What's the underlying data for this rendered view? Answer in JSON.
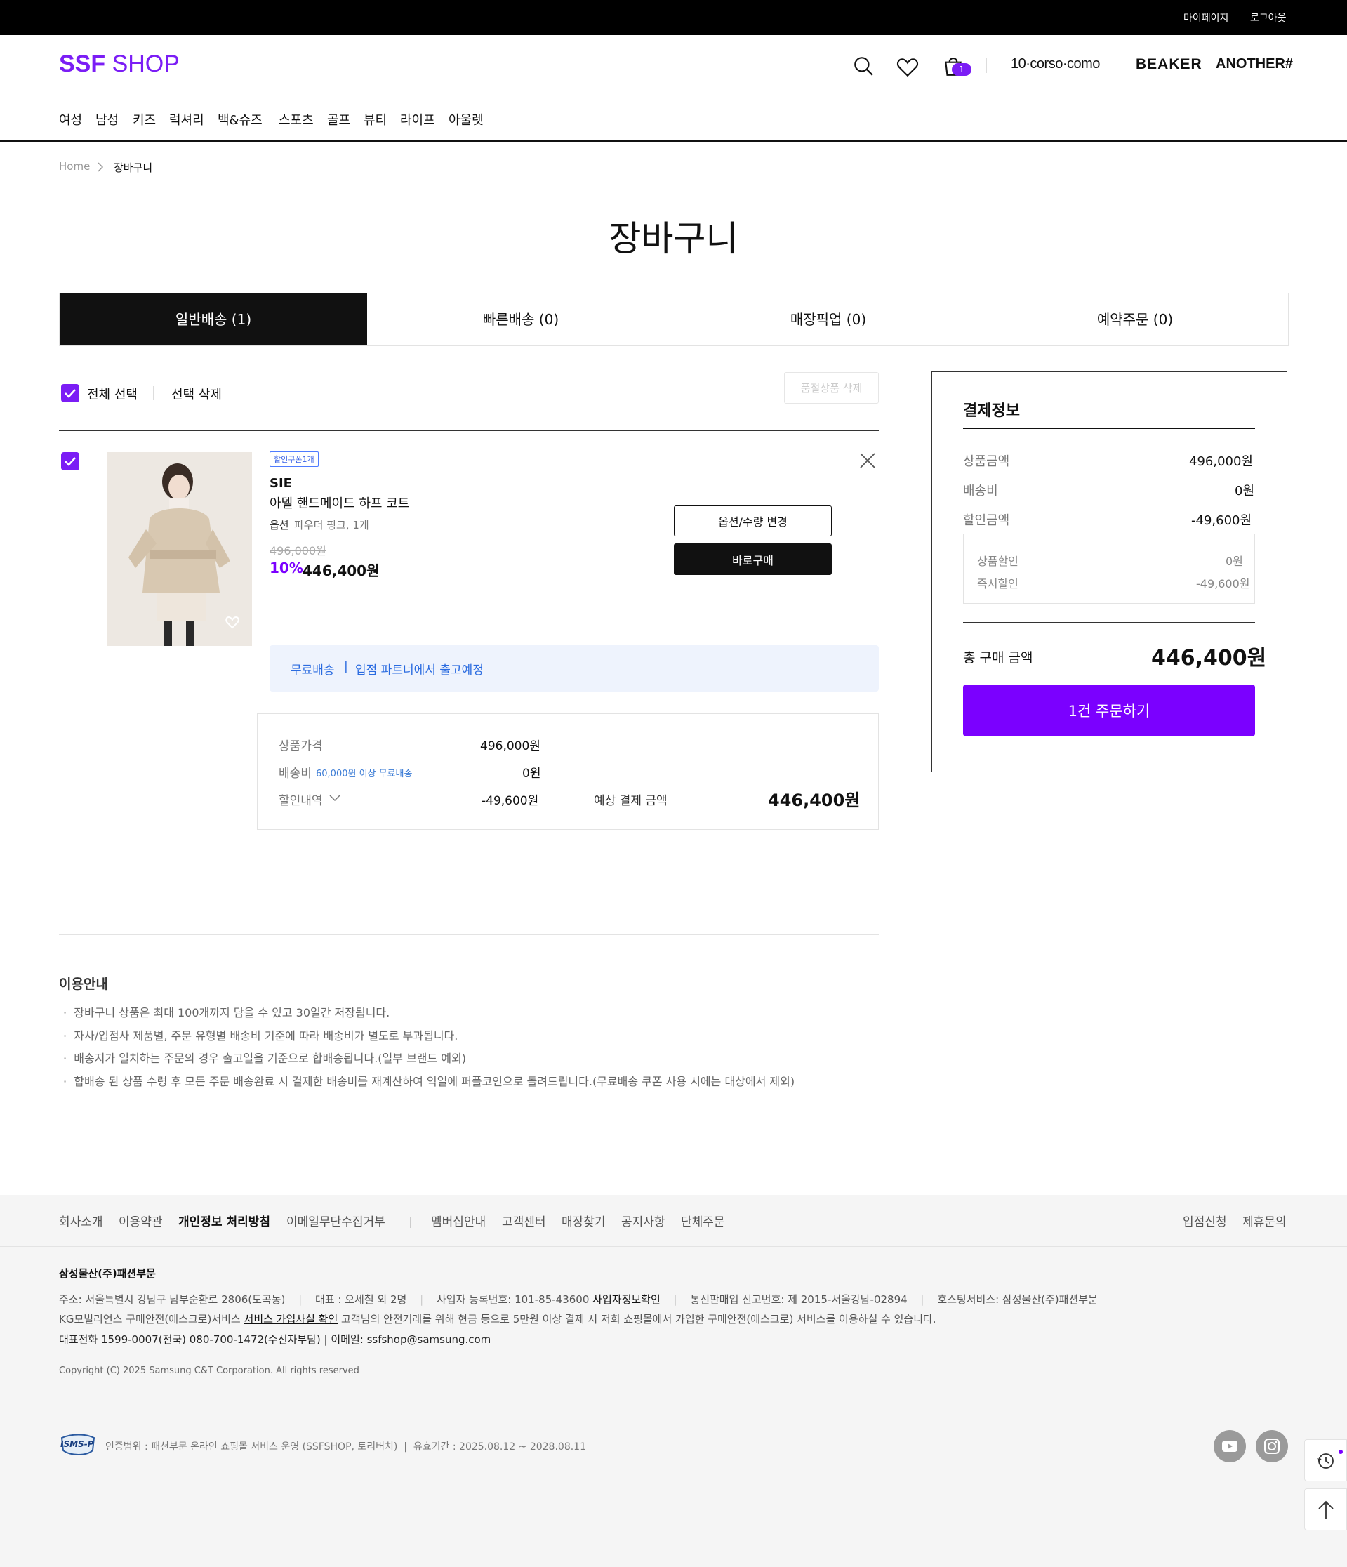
{
  "topbar": {
    "mypage": "마이페이지",
    "logout": "로그아웃"
  },
  "header": {
    "logo_bold": "SSF",
    "logo_light": "SHOP",
    "cart_count": "1",
    "brands": [
      "10·corso·como",
      "BEAKER",
      "ANOTHER#"
    ]
  },
  "nav": [
    "여성",
    "남성",
    "키즈",
    "럭셔리",
    "백&슈즈",
    "스포츠",
    "골프",
    "뷰티",
    "라이프",
    "아울렛"
  ],
  "breadcrumb": {
    "home": "Home",
    "current": "장바구니"
  },
  "page_title": "장바구니",
  "tabs": [
    "일반배송 (1)",
    "빠른배송 (0)",
    "매장픽업 (0)",
    "예약주문 (0)"
  ],
  "select": {
    "all": "전체 선택",
    "delete": "선택 삭제",
    "soldout_delete": "품절상품 삭제"
  },
  "item": {
    "coupon": "할인쿠폰1개",
    "brand": "SIE",
    "name": "아델 핸드메이드 하프 코트",
    "option_label": "옵션",
    "option_value": "파우더 핑크, 1개",
    "original_price": "496,000원",
    "discount_rate": "10%",
    "sale_price": "446,400원",
    "btn_option": "옵션/수량 변경",
    "btn_buy": "바로구매",
    "ship_free": "무료배송",
    "ship_info": "입점 파트너에서 출고예정"
  },
  "summary": {
    "price_label": "상품가격",
    "price_value": "496,000원",
    "ship_label": "배송비",
    "ship_note": "60,000원 이상 무료배송",
    "ship_value": "0원",
    "discount_label": "할인내역",
    "discount_value": "-49,600원",
    "expected_label": "예상 결제 금액",
    "expected_value": "446,400원"
  },
  "payment": {
    "title": "결제정보",
    "product_label": "상품금액",
    "product_value": "496,000원",
    "ship_label": "배송비",
    "ship_value": "0원",
    "discount_label": "할인금액",
    "discount_value": "-49,600원",
    "product_discount_label": "상품할인",
    "product_discount_value": "0원",
    "instant_discount_label": "즉시할인",
    "instant_discount_value": "-49,600원",
    "total_label": "총 구매 금액",
    "total_value": "446,400원",
    "order_button": "1건 주문하기"
  },
  "notice": {
    "title": "이용안내",
    "items": [
      "장바구니 상품은 최대 100개까지 담을 수 있고 30일간 저장됩니다.",
      "자사/입점사 제품별, 주문 유형별 배송비 기준에 따라 배송비가 별도로 부과됩니다.",
      "배송지가 일치하는 주문의 경우 출고일을 기준으로 합배송됩니다.(일부 브랜드 예외)",
      "합배송 된 상품 수령 후 모든 주문 배송완료 시 결제한 배송비를 재계산하여 익일에 퍼플코인으로 돌려드립니다.(무료배송 쿠폰 사용 시에는 대상에서 제외)"
    ]
  },
  "footer": {
    "links_left": [
      "회사소개",
      "이용약관",
      "개인정보 처리방침",
      "이메일무단수집거부"
    ],
    "links_mid": [
      "멤버십안내",
      "고객센터",
      "매장찾기",
      "공지사항",
      "단체주문"
    ],
    "links_right": [
      "입점신청",
      "제휴문의"
    ],
    "company": "삼성물산(주)패션부문",
    "address": "주소: 서울특별시 강남구 남부순환로 2806(도곡동)",
    "ceo": "대표 : 오세철 외 2명",
    "bizno": "사업자 등록번호: 101-85-43600",
    "bizno_link": "사업자정보확인",
    "telsale": "통신판매업 신고번호: 제 2015-서울강남-02894",
    "hosting": "호스팅서비스: 삼성물산(주)패션부문",
    "escrow_pre": "KG모빌리언스 구매안전(에스크로)서비스",
    "escrow_link": "서비스 가입사실 확인",
    "escrow_post": "고객님의 안전거래를 위해 현금 등으로 5만원 이상 결제 시 저희 쇼핑몰에서 가입한 구매안전(에스크로) 서비스를 이용하실 수 있습니다.",
    "contact": "대표전화 1599-0007(전국) 080-700-1472(수신자부담) | 이메일: ssfshop@samsung.com",
    "copyright": "Copyright (C) 2025 Samsung C&T Corporation. All rights reserved",
    "isms_logo": "ISMS-P",
    "isms": "인증범위 : 패션부문 온라인 쇼핑몰 서비스 운영 (SSFSHOP, 토리버치)  |  유효기간 : 2025.08.12 ~ 2028.08.11"
  }
}
